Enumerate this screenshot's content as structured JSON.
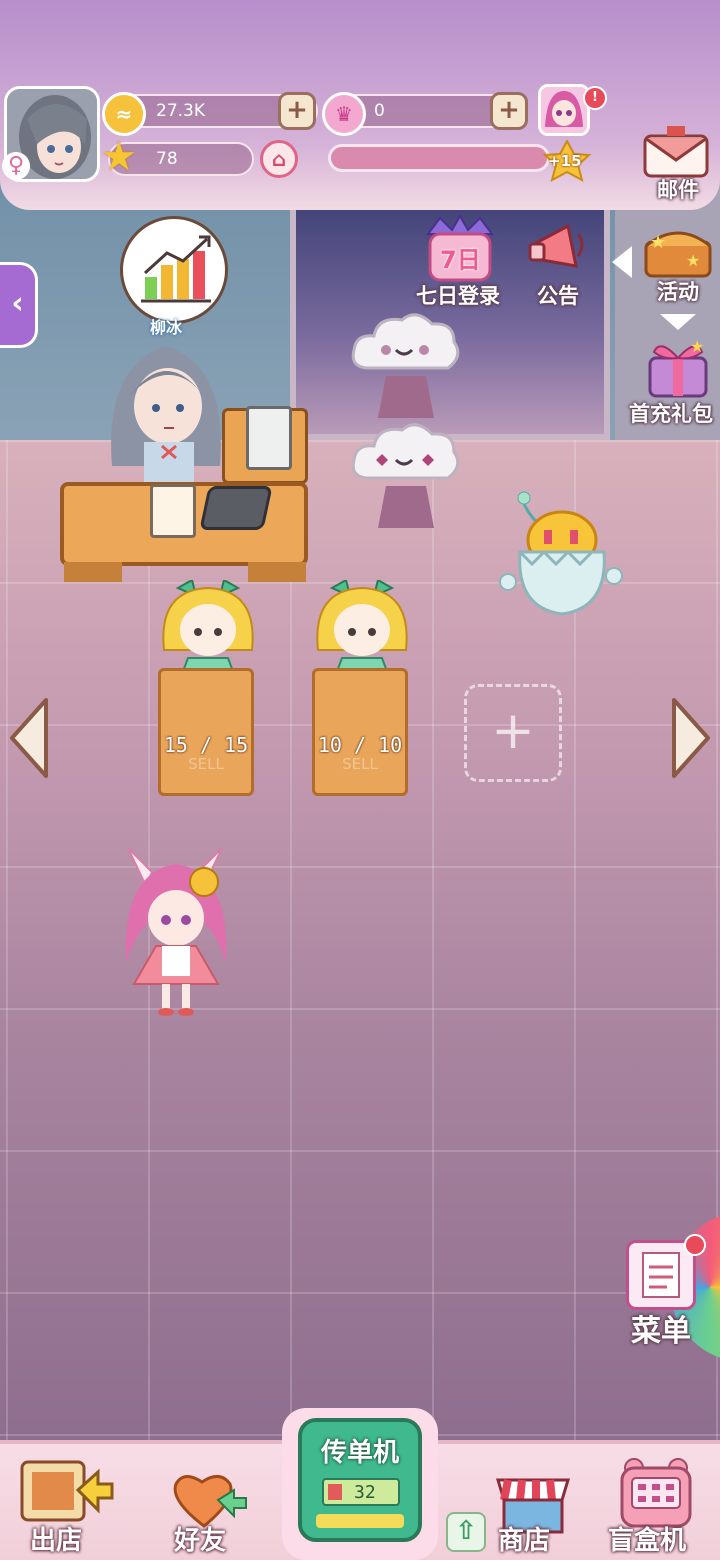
{
  "hud": {
    "gold_value": "27.3K",
    "crown_value": "0",
    "star_value": "78",
    "level_bonus": "+15",
    "avatar_gender": "female-icon"
  },
  "side_menu": {
    "mail_label": "邮件",
    "activity_label": "活动",
    "first_recharge_label": "首充礼包",
    "seven_day_label": "七日登录",
    "seven_day_badge": "7日",
    "notice_label": "公告",
    "menu_label": "菜单"
  },
  "staff": {
    "name_tag": "柳冰"
  },
  "shelves": [
    {
      "count": "15 / 15",
      "sign": "SELL"
    },
    {
      "count": "10 / 10",
      "sign": "SELL"
    }
  ],
  "bottom": {
    "leave_label": "出店",
    "friends_label": "好友",
    "flyer_title": "传单机",
    "flyer_count": "32",
    "shop_label": "商店",
    "blindbox_label": "盲盒机"
  },
  "colors": {
    "accent_pink": "#e86aa0",
    "flyer_green": "#3fb98d",
    "gold": "#f4c13b"
  }
}
